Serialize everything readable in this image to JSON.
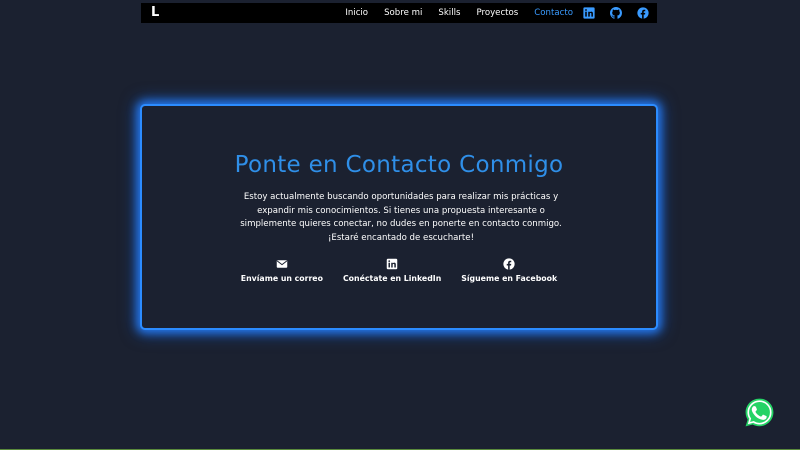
{
  "navbar": {
    "logo": "L",
    "links": [
      {
        "label": "Inicio"
      },
      {
        "label": "Sobre mi"
      },
      {
        "label": "Skills"
      },
      {
        "label": "Proyectos"
      },
      {
        "label": "Contacto",
        "active": true
      }
    ],
    "icons": [
      "linkedin-icon",
      "github-icon",
      "facebook-icon"
    ],
    "icon_color": "#3a9bff",
    "active_color": "#3a9bff"
  },
  "contact": {
    "title": "Ponte en Contacto Conmigo",
    "description": "Estoy actualmente buscando oportunidades para realizar mis prácticas y expandir mis conocimientos. Si tienes una propuesta interesante o simplemente quieres conectar, no dudes en ponerte en contacto conmigo. ¡Estaré encantado de escucharte!",
    "links": [
      {
        "label": "Envíame un correo",
        "icon": "envelope-icon"
      },
      {
        "label": "Conéctate en LinkedIn",
        "icon": "linkedin-icon"
      },
      {
        "label": "Sígueme en Facebook",
        "icon": "facebook-icon"
      }
    ],
    "accent_color": "#2c8cff"
  },
  "whatsapp": {
    "icon": "whatsapp-icon",
    "color": "#25d366"
  },
  "colors": {
    "background": "#1b2130",
    "navbar_bg": "#000000",
    "title": "#2f8fe8"
  }
}
